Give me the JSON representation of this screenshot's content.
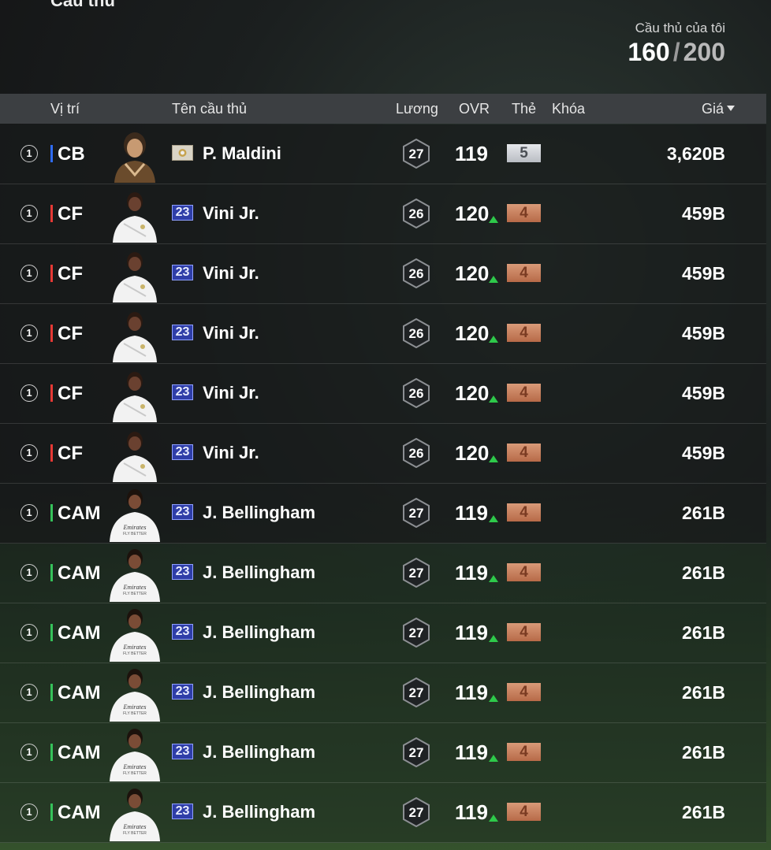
{
  "page": {
    "section_title": "Cầu thủ"
  },
  "my_players": {
    "label": "Cầu thủ của tôi",
    "current": "160",
    "separator": "/",
    "max": "200"
  },
  "columns": {
    "position": "Vị trí",
    "name": "Tên cầu thủ",
    "salary": "Lương",
    "ovr": "OVR",
    "card": "Thẻ",
    "lock": "Khóa",
    "price": "Giá"
  },
  "colors": {
    "cb": "#2f6cf5",
    "cf": "#e53935",
    "cam": "#35c25a",
    "up": "#2ec94a"
  },
  "players": [
    {
      "qty": "1",
      "position": "CB",
      "position_color": "#2f6cf5",
      "season": "",
      "season_type": "icon",
      "name": "P. Maldini",
      "salary": "27",
      "ovr": "119",
      "ovr_up": false,
      "grade": "5",
      "grade_type": "silver",
      "price": "3,620B",
      "avatar": "maldini-avatar"
    },
    {
      "qty": "1",
      "position": "CF",
      "position_color": "#e53935",
      "season": "23",
      "season_type": "s23",
      "name": "Vini Jr.",
      "salary": "26",
      "ovr": "120",
      "ovr_up": true,
      "grade": "4",
      "grade_type": "bronze",
      "price": "459B",
      "avatar": "vini-avatar"
    },
    {
      "qty": "1",
      "position": "CF",
      "position_color": "#e53935",
      "season": "23",
      "season_type": "s23",
      "name": "Vini Jr.",
      "salary": "26",
      "ovr": "120",
      "ovr_up": true,
      "grade": "4",
      "grade_type": "bronze",
      "price": "459B",
      "avatar": "vini-avatar"
    },
    {
      "qty": "1",
      "position": "CF",
      "position_color": "#e53935",
      "season": "23",
      "season_type": "s23",
      "name": "Vini Jr.",
      "salary": "26",
      "ovr": "120",
      "ovr_up": true,
      "grade": "4",
      "grade_type": "bronze",
      "price": "459B",
      "avatar": "vini-avatar"
    },
    {
      "qty": "1",
      "position": "CF",
      "position_color": "#e53935",
      "season": "23",
      "season_type": "s23",
      "name": "Vini Jr.",
      "salary": "26",
      "ovr": "120",
      "ovr_up": true,
      "grade": "4",
      "grade_type": "bronze",
      "price": "459B",
      "avatar": "vini-avatar"
    },
    {
      "qty": "1",
      "position": "CF",
      "position_color": "#e53935",
      "season": "23",
      "season_type": "s23",
      "name": "Vini Jr.",
      "salary": "26",
      "ovr": "120",
      "ovr_up": true,
      "grade": "4",
      "grade_type": "bronze",
      "price": "459B",
      "avatar": "vini-avatar"
    },
    {
      "qty": "1",
      "position": "CAM",
      "position_color": "#35c25a",
      "season": "23",
      "season_type": "s23",
      "name": "J. Bellingham",
      "salary": "27",
      "ovr": "119",
      "ovr_up": true,
      "grade": "4",
      "grade_type": "bronze",
      "price": "261B",
      "avatar": "bellingham-avatar"
    },
    {
      "qty": "1",
      "position": "CAM",
      "position_color": "#35c25a",
      "season": "23",
      "season_type": "s23",
      "name": "J. Bellingham",
      "salary": "27",
      "ovr": "119",
      "ovr_up": true,
      "grade": "4",
      "grade_type": "bronze",
      "price": "261B",
      "avatar": "bellingham-avatar"
    },
    {
      "qty": "1",
      "position": "CAM",
      "position_color": "#35c25a",
      "season": "23",
      "season_type": "s23",
      "name": "J. Bellingham",
      "salary": "27",
      "ovr": "119",
      "ovr_up": true,
      "grade": "4",
      "grade_type": "bronze",
      "price": "261B",
      "avatar": "bellingham-avatar"
    },
    {
      "qty": "1",
      "position": "CAM",
      "position_color": "#35c25a",
      "season": "23",
      "season_type": "s23",
      "name": "J. Bellingham",
      "salary": "27",
      "ovr": "119",
      "ovr_up": true,
      "grade": "4",
      "grade_type": "bronze",
      "price": "261B",
      "avatar": "bellingham-avatar"
    },
    {
      "qty": "1",
      "position": "CAM",
      "position_color": "#35c25a",
      "season": "23",
      "season_type": "s23",
      "name": "J. Bellingham",
      "salary": "27",
      "ovr": "119",
      "ovr_up": true,
      "grade": "4",
      "grade_type": "bronze",
      "price": "261B",
      "avatar": "bellingham-avatar"
    },
    {
      "qty": "1",
      "position": "CAM",
      "position_color": "#35c25a",
      "season": "23",
      "season_type": "s23",
      "name": "J. Bellingham",
      "salary": "27",
      "ovr": "119",
      "ovr_up": true,
      "grade": "4",
      "grade_type": "bronze",
      "price": "261B",
      "avatar": "bellingham-avatar"
    }
  ]
}
